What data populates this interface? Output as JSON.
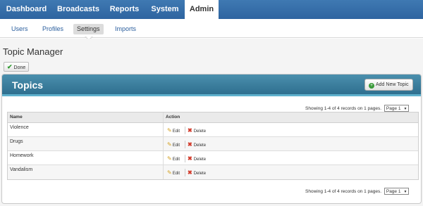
{
  "topnav": {
    "items": [
      "Dashboard",
      "Broadcasts",
      "Reports",
      "System",
      "Admin"
    ],
    "active": "Admin"
  },
  "subnav": {
    "items": [
      "Users",
      "Profiles",
      "Settings",
      "Imports"
    ],
    "active": "Settings"
  },
  "page": {
    "title": "Topic Manager",
    "done_label": "Done"
  },
  "panel": {
    "title": "Topics",
    "add_label": "Add New Topic",
    "pager_text": "Showing 1-4 of 4 records on 1 pages.",
    "page_select": "Page 1"
  },
  "table": {
    "headers": [
      "Name",
      "Action"
    ],
    "rows": [
      "Violence",
      "Drugs",
      "Homework",
      "Vandalism"
    ],
    "edit_label": "Edit",
    "delete_label": "Delete"
  },
  "icons": {
    "done": "check-icon",
    "add": "plus-circle-icon",
    "edit": "pencil-icon",
    "delete": "x-icon"
  },
  "colors": {
    "nav": "#3f79b2",
    "panel_header": "#3b7f9f",
    "accent_border": "#5fb1cd"
  }
}
